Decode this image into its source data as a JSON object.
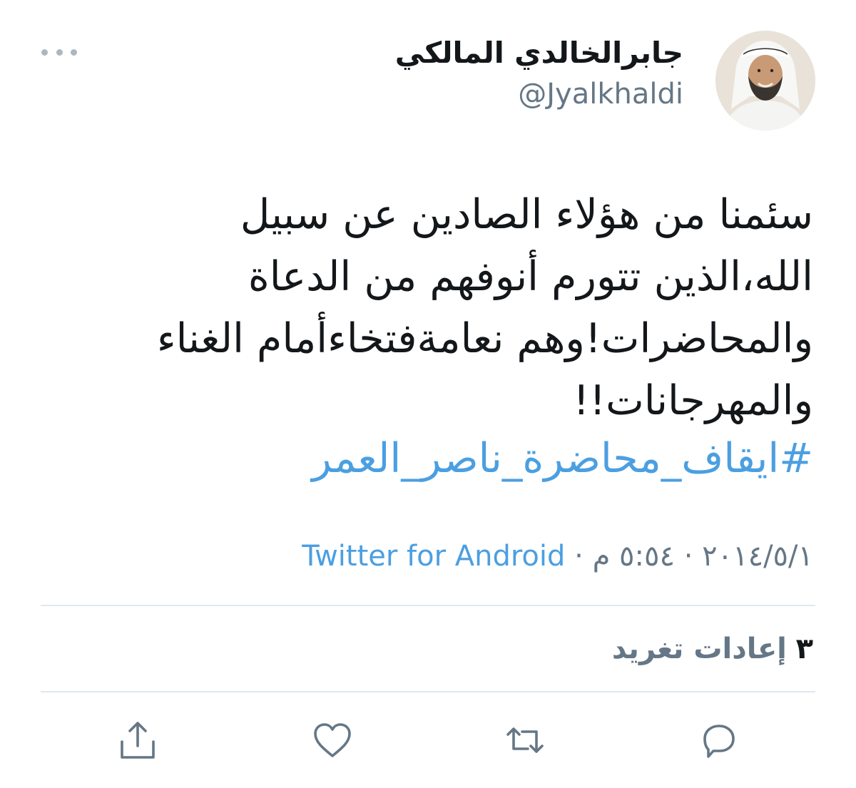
{
  "author": {
    "name": "جابرالخالدي المالكي",
    "handle": "@Jyalkhaldi"
  },
  "tweet": {
    "text": "سئمنا من هؤلاء الصادين عن سبيل\nالله،الذين تتورم أنوفهم من الدعاة\nوالمحاضرات!وهم نعامةفتخاءأمام الغناء\nوالمهرجانات!!",
    "hashtag": "#ايقاف_محاضرة_ناصر_العمر"
  },
  "meta": {
    "date": "٢٠١٤/٥/١",
    "separator": "·",
    "time": "٥:٥٤ م",
    "source": "Twitter for Android"
  },
  "stats": {
    "retweets_count": "٣",
    "retweets_label": "إعادات تغريد"
  },
  "actions": {
    "icons": [
      "reply-icon",
      "retweet-icon",
      "like-icon",
      "share-icon"
    ]
  },
  "colors": {
    "text": "#14171a",
    "secondary": "#657786",
    "link": "#4b9fe1",
    "divider": "#e1e8ed",
    "icon": "#657786"
  }
}
